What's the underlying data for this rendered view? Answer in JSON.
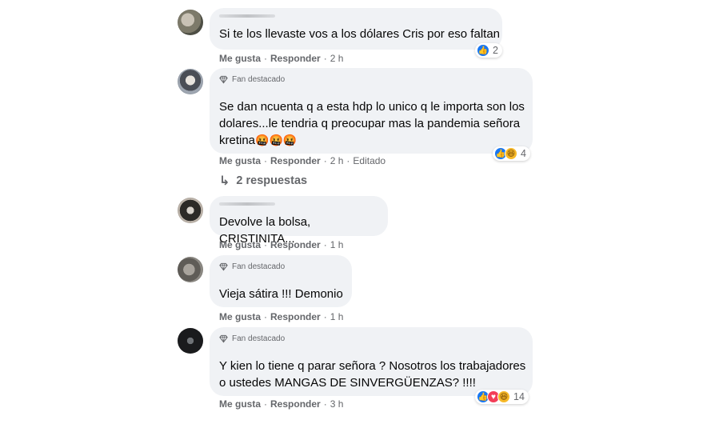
{
  "fan_label": "Fan destacado",
  "comments": [
    {
      "text": "Si te los llevaste vos a los dólares Cris por eso faltan",
      "like": "Me gusta",
      "reply": "Responder",
      "time": "2 h",
      "reactions": [
        "like"
      ],
      "count": "2"
    },
    {
      "text": "Se dan ncuenta q a esta hdp lo unico q le importa son los\ndolares...le tendria q preocupar mas la pandemia señora\nkretina",
      "emojis": "🤬🤬🤬",
      "like": "Me gusta",
      "reply": "Responder",
      "time": "2 h",
      "edited": "Editado",
      "reactions": [
        "like",
        "haha"
      ],
      "count": "4",
      "replies": "2 respuestas"
    },
    {
      "text": "Devolve la bolsa, CRISTINITA...",
      "like": "Me gusta",
      "reply": "Responder",
      "time": "1 h"
    },
    {
      "text": "Vieja sátira !!! Demonio",
      "like": "Me gusta",
      "reply": "Responder",
      "time": "1 h"
    },
    {
      "text": "Y kien lo tiene q parar señora ? Nosotros los trabajadores\no ustedes MANGAS DE SINVERGÜENZAS? !!!!",
      "like": "Me gusta",
      "reply": "Responder",
      "time": "3 h",
      "reactions": [
        "like",
        "love",
        "haha"
      ],
      "count": "14"
    }
  ],
  "colors": {
    "bubble": "#f0f2f5",
    "meta_text": "#65676b",
    "like_blue": "#1877f2",
    "love_red": "#f33e58",
    "haha_yellow": "#f7b928"
  }
}
